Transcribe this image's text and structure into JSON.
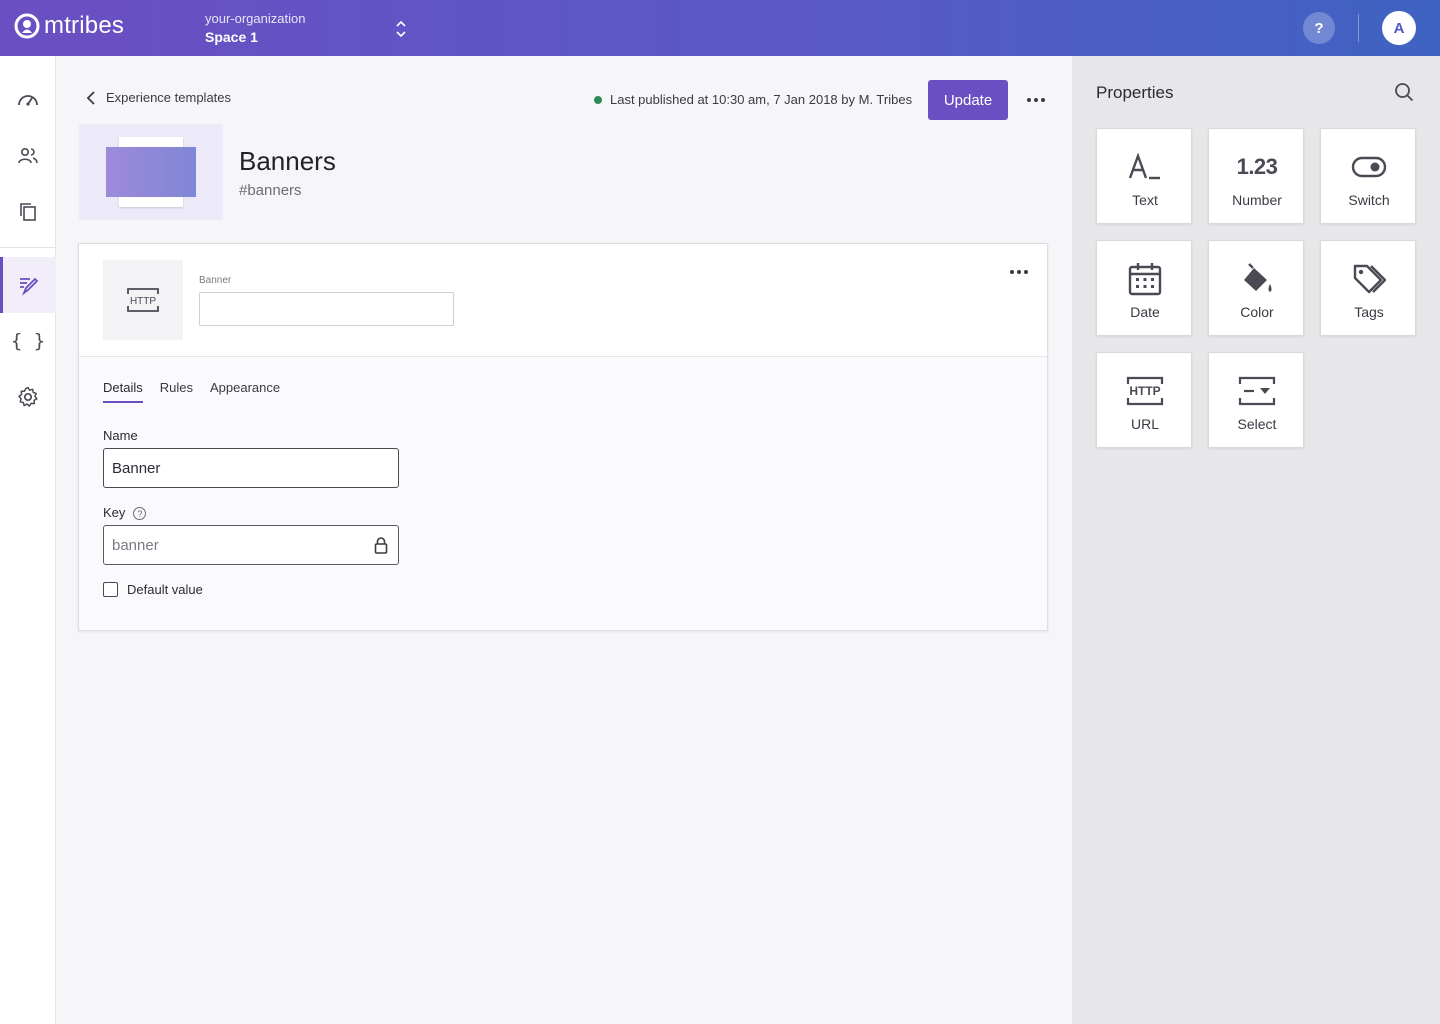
{
  "topbar": {
    "brand": "mtribes",
    "org_name": "your-organization",
    "space_name": "Space 1",
    "help_label": "?",
    "avatar_initial": "A"
  },
  "rail": {
    "items": [
      "dashboard-icon",
      "users-icon",
      "copy-icon",
      "edit-icon",
      "braces-icon",
      "settings-icon"
    ],
    "braces_glyph": "{ }",
    "active_index": 3
  },
  "header": {
    "back_label": "Experience templates",
    "published_text": "Last published at 10:30 am, 7 Jan 2018 by M. Tribes",
    "published_status_color": "#2e8b57",
    "update_label": "Update"
  },
  "template": {
    "title": "Banners",
    "key": "#banners"
  },
  "card": {
    "icon_text": "HTTP",
    "field_caption": "Banner",
    "field_value": "",
    "tabs": [
      {
        "label": "Details",
        "active": true
      },
      {
        "label": "Rules",
        "active": false
      },
      {
        "label": "Appearance",
        "active": false
      }
    ],
    "name_label": "Name",
    "name_value": "Banner",
    "key_label": "Key",
    "key_value": "banner",
    "help_glyph": "?",
    "default_value_label": "Default value",
    "default_value_checked": false
  },
  "properties": {
    "title": "Properties",
    "number_glyph": "1.23",
    "url_glyph": "HTTP",
    "tiles": [
      {
        "label": "Text",
        "icon": "text-icon"
      },
      {
        "label": "Number",
        "icon": "number-icon"
      },
      {
        "label": "Switch",
        "icon": "switch-icon"
      },
      {
        "label": "Date",
        "icon": "calendar-icon"
      },
      {
        "label": "Color",
        "icon": "paint-bucket-icon"
      },
      {
        "label": "Tags",
        "icon": "tags-icon"
      },
      {
        "label": "URL",
        "icon": "http-icon"
      },
      {
        "label": "Select",
        "icon": "select-icon"
      }
    ]
  },
  "colors": {
    "accent": "#6a4fc2",
    "topbar_start": "#6a4fc2",
    "topbar_end": "#3f63c2"
  }
}
